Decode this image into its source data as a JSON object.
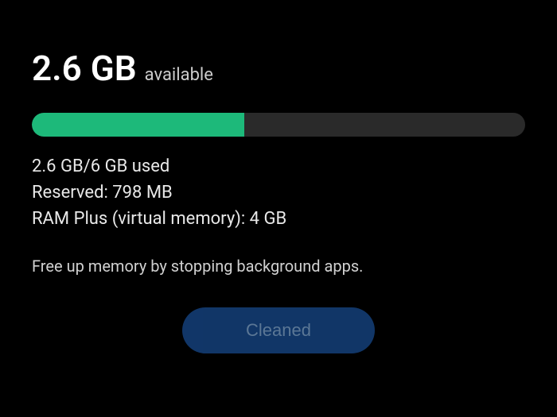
{
  "memory": {
    "available_amount": "2.6 GB",
    "available_label": "available",
    "used_text": "2.6 GB/6 GB used",
    "reserved_text": "Reserved: 798 MB",
    "ram_plus_text": "RAM Plus (virtual memory): 4 GB",
    "progress_percent": 43
  },
  "hint": "Free up memory by stopping background apps.",
  "button": {
    "label": "Cleaned"
  },
  "colors": {
    "accent": "#1db97a",
    "button_bg": "#14407a"
  }
}
